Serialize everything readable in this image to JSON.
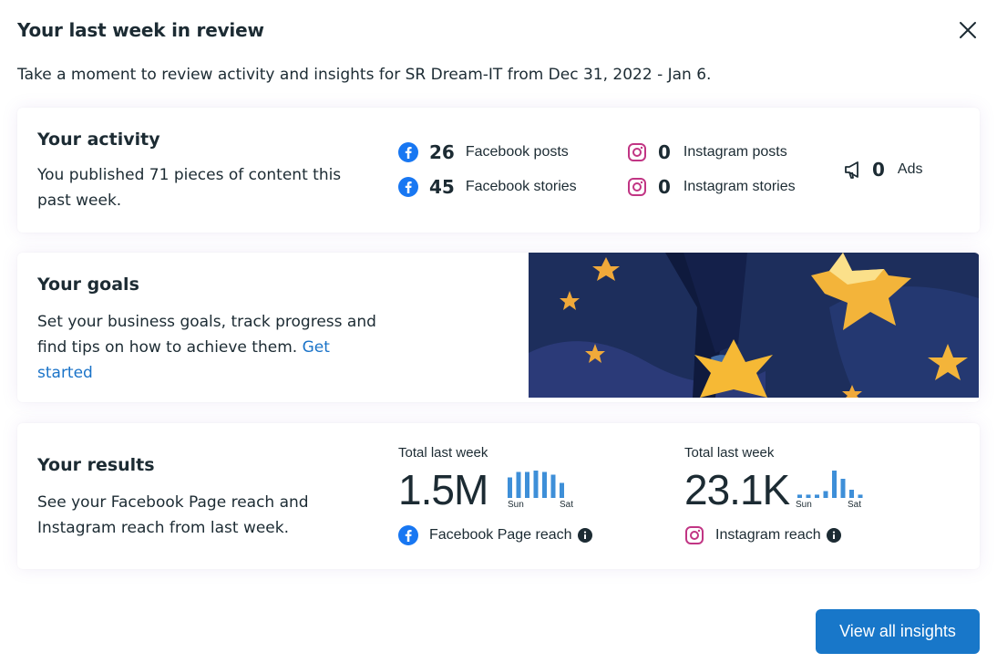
{
  "header": {
    "title": "Your last week in review",
    "subtitle": "Take a moment to review activity and insights for SR Dream-IT from Dec 31, 2022 - Jan 6."
  },
  "activity": {
    "title": "Your activity",
    "text": "You published 71 pieces of content this past week.",
    "stats": {
      "fb_posts": {
        "value": "26",
        "label": "Facebook posts",
        "icon": "facebook-icon"
      },
      "fb_stories": {
        "value": "45",
        "label": "Facebook stories",
        "icon": "facebook-icon"
      },
      "ig_posts": {
        "value": "0",
        "label": "Instagram posts",
        "icon": "instagram-icon"
      },
      "ig_stories": {
        "value": "0",
        "label": "Instagram stories",
        "icon": "instagram-icon"
      },
      "ads": {
        "value": "0",
        "label": "Ads",
        "icon": "megaphone-icon"
      }
    }
  },
  "goals": {
    "title": "Your goals",
    "text": "Set your business goals, track progress and find tips on how to achieve them.",
    "link": "Get started"
  },
  "results": {
    "title": "Your results",
    "text": "See your Facebook Page reach and Instagram reach from last week.",
    "facebook": {
      "caption": "Total last week",
      "value": "1.5M",
      "label": "Facebook Page reach",
      "spark_start": "Sun",
      "spark_end": "Sat",
      "spark_values": [
        0.75,
        0.95,
        0.95,
        1.0,
        0.95,
        0.85,
        0.55
      ]
    },
    "instagram": {
      "caption": "Total last week",
      "value": "23.1K",
      "label": "Instagram reach",
      "spark_start": "Sun",
      "spark_end": "Sat",
      "spark_values": [
        0.12,
        0.12,
        0.12,
        0.25,
        1.0,
        0.7,
        0.3,
        0.12
      ]
    }
  },
  "footer": {
    "button": "View all insights"
  },
  "colors": {
    "accent": "#1877c9",
    "facebook": "#1877f2",
    "instagram": "#c13584",
    "spark": "#3e8fd8"
  }
}
